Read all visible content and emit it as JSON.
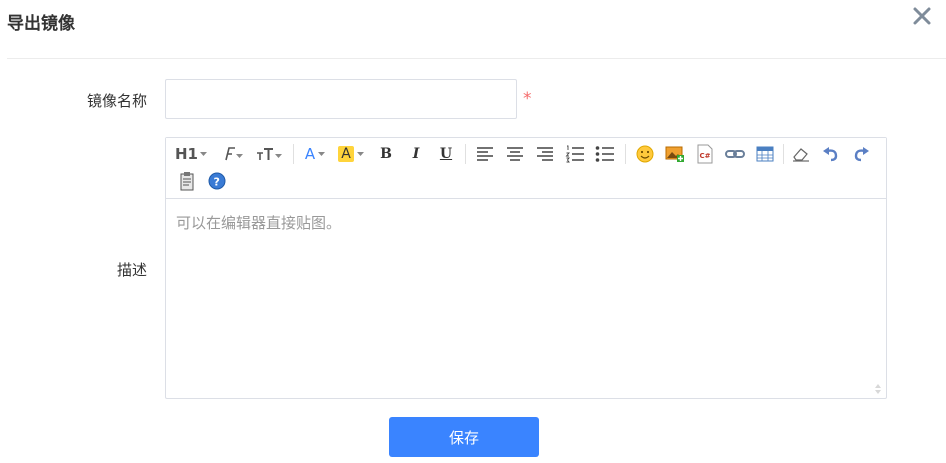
{
  "dialog": {
    "title": "导出镜像",
    "close_icon": "close-icon"
  },
  "form": {
    "name_label": "镜像名称",
    "name_value": "",
    "name_placeholder": "",
    "required_mark": "*",
    "desc_label": "描述",
    "desc_placeholder": "可以在编辑器直接贴图。"
  },
  "toolbar": {
    "heading": "H1",
    "bold": "B",
    "italic": "I",
    "underline": "U",
    "font_color": "A",
    "highlight": "A",
    "highlight_color": "#ffd43b",
    "font_color_hex": "#3a84ff"
  },
  "actions": {
    "save_label": "保存"
  },
  "colors": {
    "accent": "#3a84ff",
    "required": "#f56c6c"
  }
}
